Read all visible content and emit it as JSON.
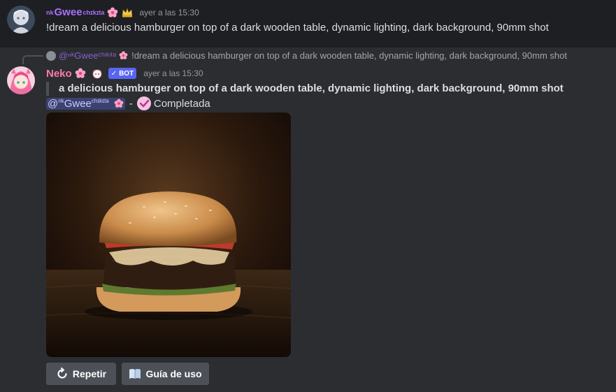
{
  "message1": {
    "author": {
      "prefix": "nk",
      "name": "Gwee",
      "suffix": "chɪkɪta"
    },
    "timestamp": "ayer a las 15:30",
    "content": "!dream a delicious hamburger on top of a dark wooden table, dynamic lighting, dark background, 90mm shot"
  },
  "message2": {
    "reply": {
      "author_display": "@ⁿᵏGweeᶜʰᶦᵏᶦᵗᵃ",
      "content": "!dream a delicious hamburger on top of a dark wooden table, dynamic lighting, dark background, 90mm shot"
    },
    "author": "Neko",
    "bot_tag": "BOT",
    "timestamp": "ayer a las 15:30",
    "quote": "a delicious hamburger on top of a dark wooden table, dynamic lighting, dark background, 90mm shot",
    "mention": {
      "at": "@",
      "prefix": "nk",
      "name": "Gwee",
      "suffix": "chɪkɪta"
    },
    "separator": "-",
    "status": "Completada",
    "buttons": {
      "repeat": "Repetir",
      "guide": "Guía de uso"
    }
  },
  "icons": {
    "flower": "cherry-blossom-icon",
    "crown": "crown-icon",
    "check": "check-circle-icon",
    "repeat": "refresh-icon",
    "book": "book-icon"
  },
  "colors": {
    "bg": "#2b2d31",
    "header_bg": "#1e1f22",
    "user_name": "#a970ff",
    "bot_name": "#ff7aa8",
    "bot_tag": "#5865f2",
    "button": "#4e5058"
  }
}
